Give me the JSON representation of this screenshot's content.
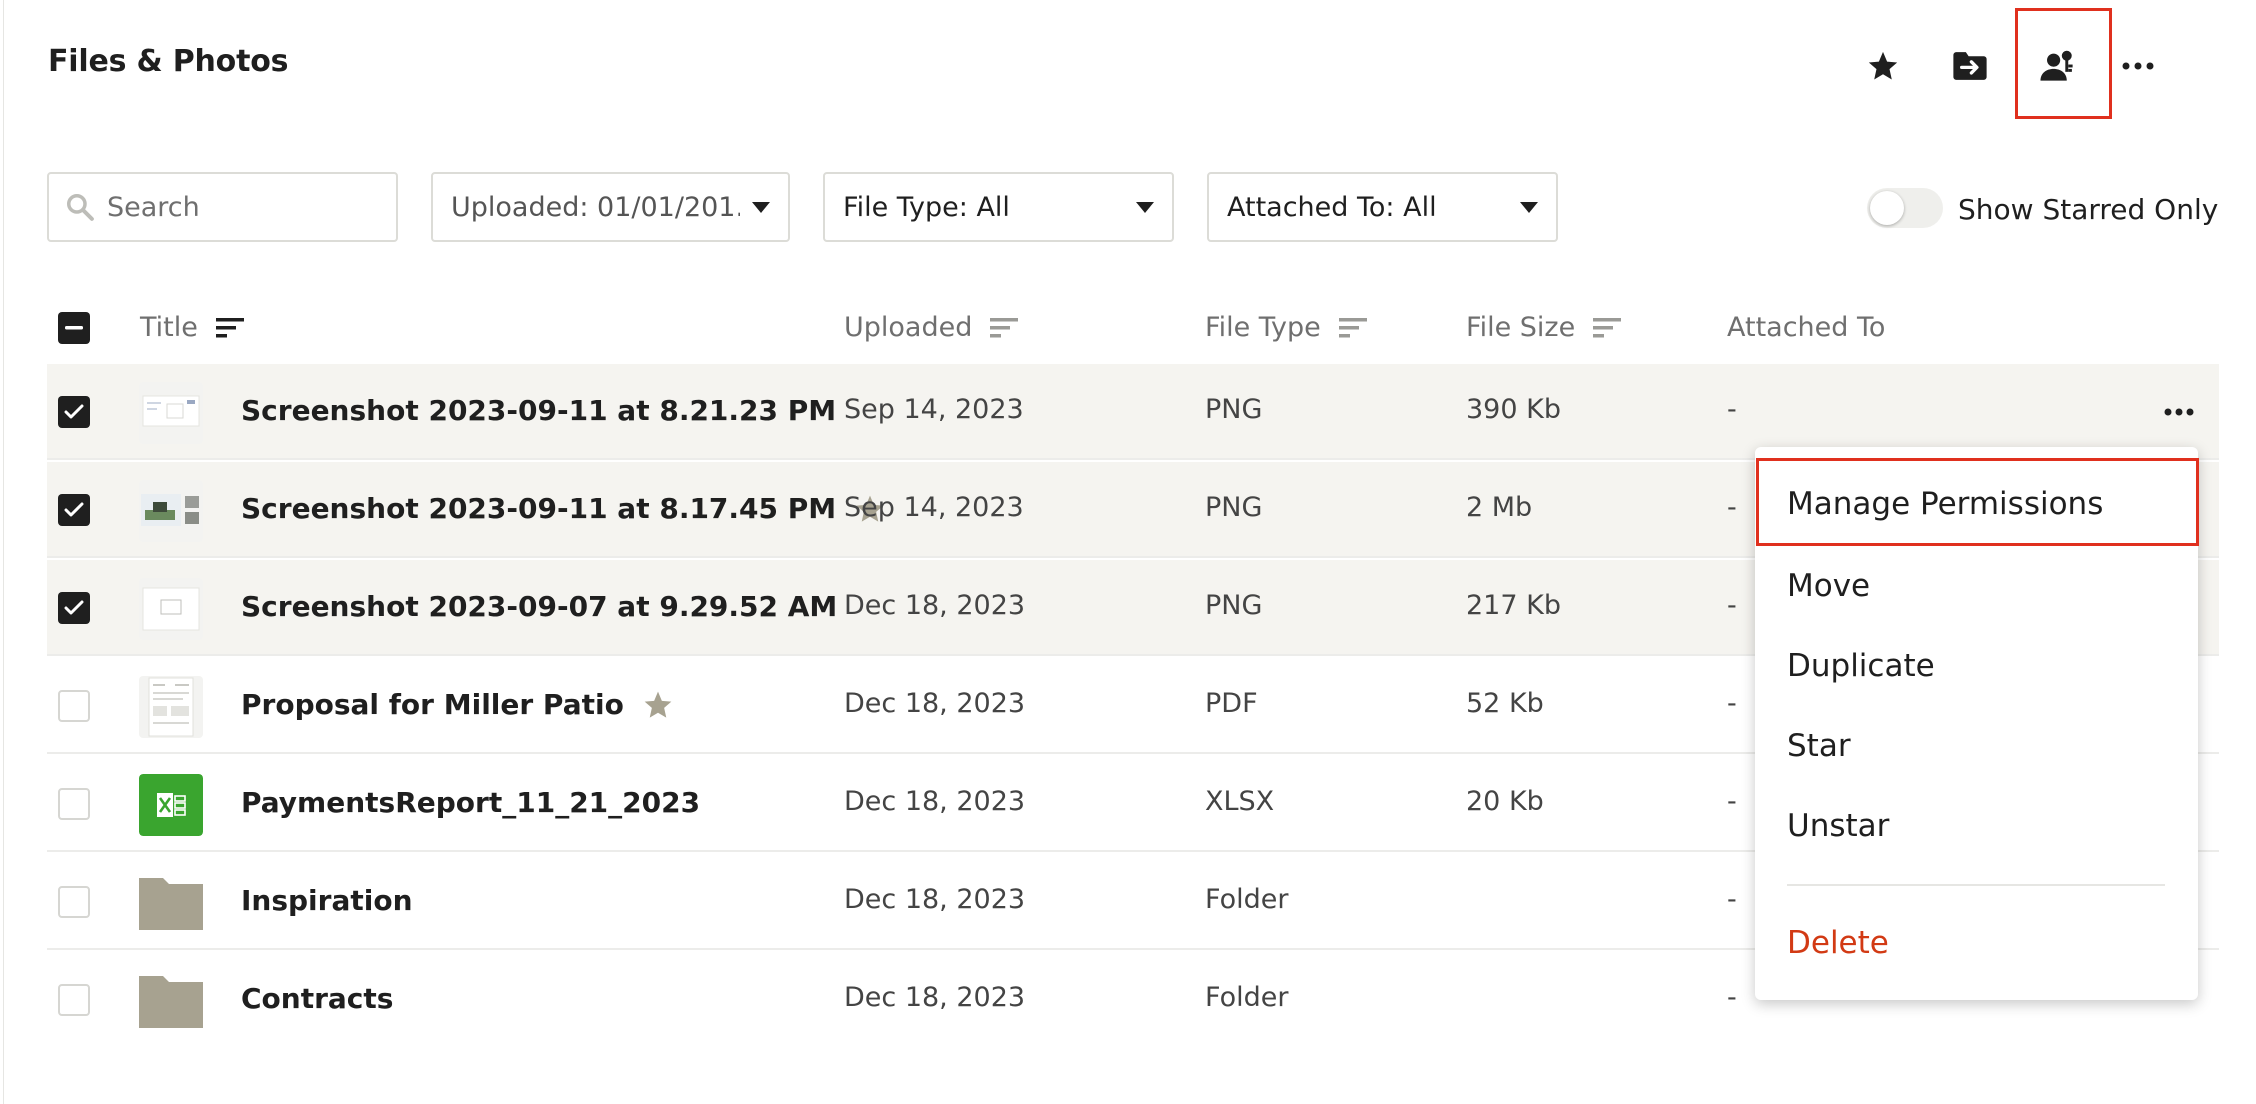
{
  "header": {
    "title": "Files & Photos",
    "icons": [
      "star-icon",
      "move-to-folder-icon",
      "manage-permissions-icon",
      "more-icon"
    ]
  },
  "filters": {
    "search_placeholder": "Search",
    "uploaded": "Uploaded: 01/01/201...",
    "file_type": "File Type: All",
    "attached_to": "Attached To: All",
    "starred_toggle_label": "Show Starred Only",
    "starred_toggle_on": false
  },
  "table": {
    "columns": [
      "Title",
      "Uploaded",
      "File Type",
      "File Size",
      "Attached To"
    ],
    "rows": [
      {
        "title": "Screenshot 2023-09-11 at 8.21.23 PM",
        "uploaded": "Sep 14, 2023",
        "type": "PNG",
        "size": "390 Kb",
        "attached": "-",
        "checked": true,
        "starred": false,
        "thumb": "screenshot"
      },
      {
        "title": "Screenshot 2023-09-11 at 8.17.45 PM",
        "uploaded": "Sep 14, 2023",
        "type": "PNG",
        "size": "2 Mb",
        "attached": "-",
        "checked": true,
        "starred": true,
        "thumb": "screenshot-green"
      },
      {
        "title": "Screenshot 2023-09-07 at 9.29.52 AM",
        "uploaded": "Dec 18, 2023",
        "type": "PNG",
        "size": "217 Kb",
        "attached": "-",
        "checked": true,
        "starred": false,
        "thumb": "screenshot-blank"
      },
      {
        "title": "Proposal for Miller Patio",
        "uploaded": "Dec 18, 2023",
        "type": "PDF",
        "size": "52 Kb",
        "attached": "-",
        "checked": false,
        "starred": true,
        "thumb": "document"
      },
      {
        "title": "PaymentsReport_11_21_2023",
        "uploaded": "Dec 18, 2023",
        "type": "XLSX",
        "size": "20 Kb",
        "attached": "-",
        "checked": false,
        "starred": false,
        "thumb": "excel"
      },
      {
        "title": "Inspiration",
        "uploaded": "Dec 18, 2023",
        "type": "Folder",
        "size": "",
        "attached": "-",
        "checked": false,
        "starred": false,
        "thumb": "folder"
      },
      {
        "title": "Contracts",
        "uploaded": "Dec 18, 2023",
        "type": "Folder",
        "size": "",
        "attached": "-",
        "checked": false,
        "starred": false,
        "thumb": "folder"
      }
    ]
  },
  "context_menu": {
    "items": [
      "Manage Permissions",
      "Move",
      "Duplicate",
      "Star",
      "Unstar"
    ],
    "delete": "Delete"
  },
  "colors": {
    "highlight": "#e0301e",
    "delete": "#d23a14",
    "selected_row": "#f5f4f0",
    "folder": "#a7a290",
    "excel": "#3aa52f",
    "star": "#a7a290"
  }
}
